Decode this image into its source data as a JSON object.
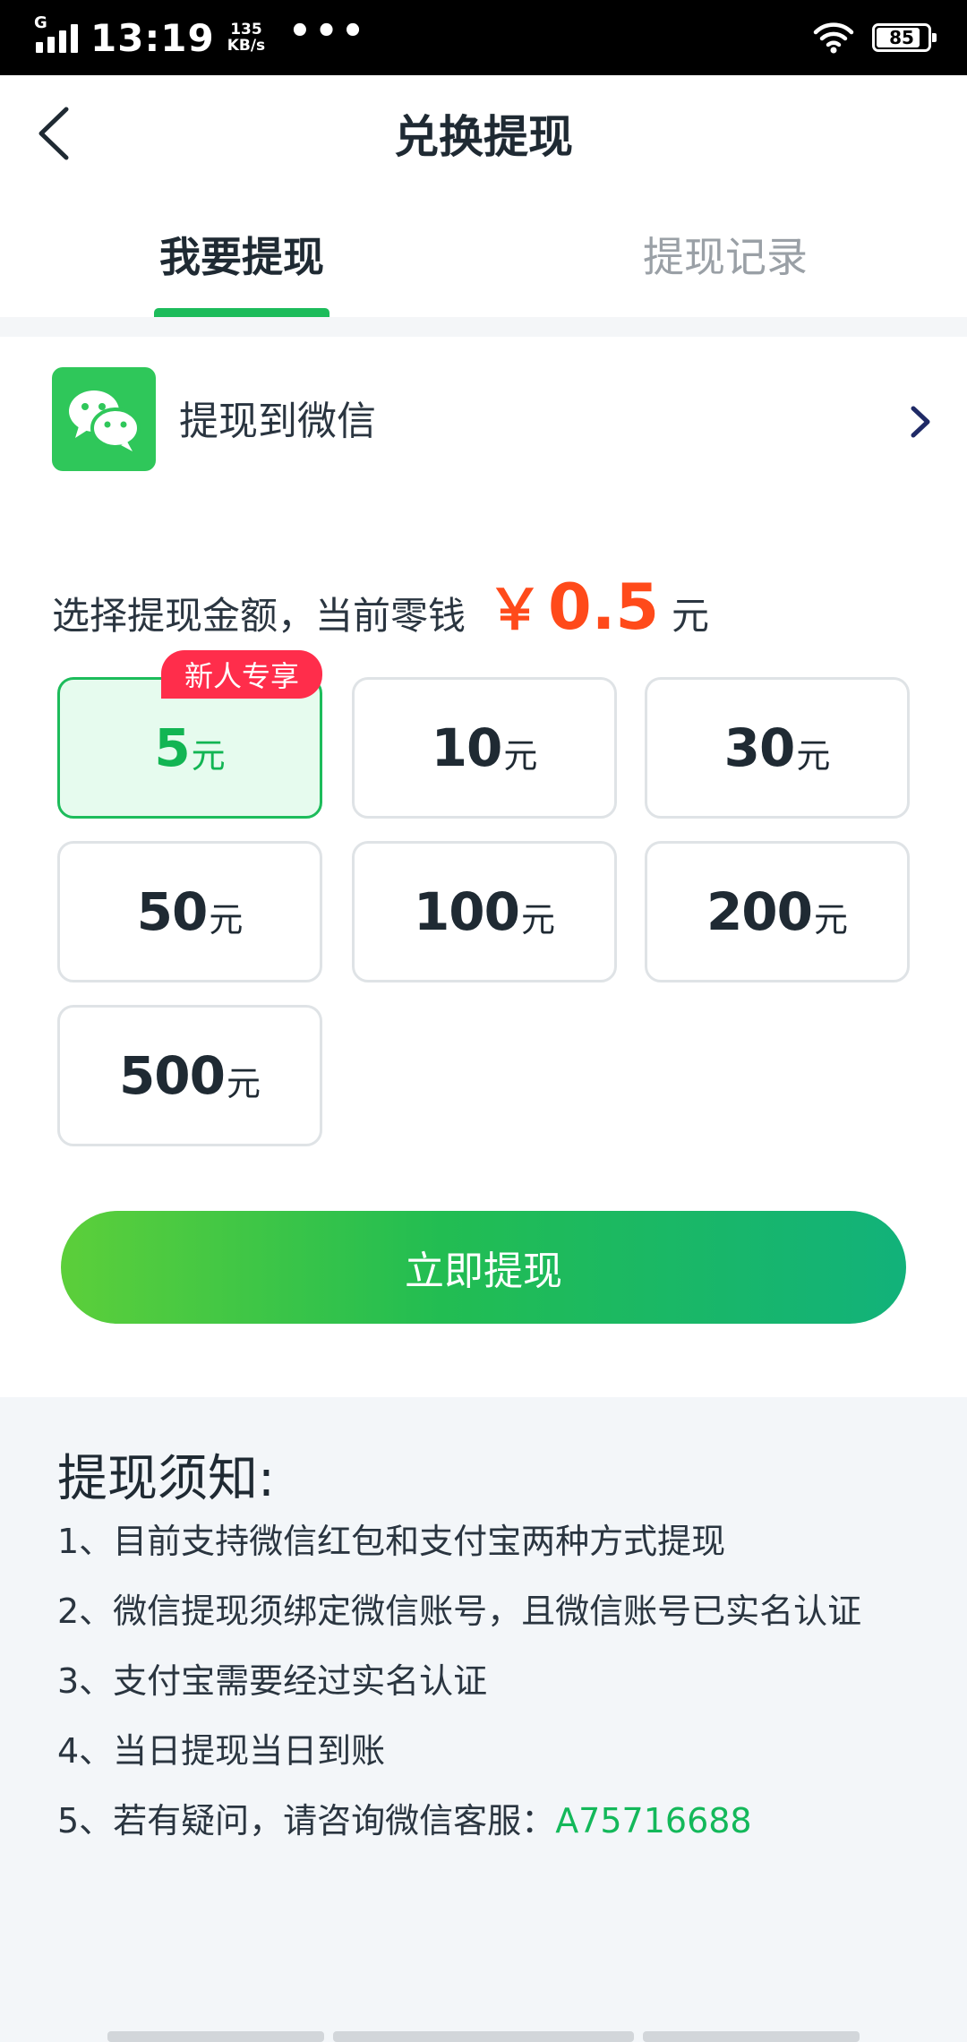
{
  "status_bar": {
    "network": "G",
    "time": "13:19",
    "speed_value": "135",
    "speed_unit": "KB/s",
    "more": "•••",
    "battery": "85",
    "battery_level": 0.85
  },
  "header": {
    "back_icon": "back-arrow-icon",
    "title": "兑换提现"
  },
  "tabs": [
    {
      "label": "我要提现",
      "active": true
    },
    {
      "label": "提现记录",
      "active": false
    }
  ],
  "withdraw_method": {
    "icon": "wechat-icon",
    "label": "提现到微信",
    "chevron_icon": "chevron-right-icon"
  },
  "amount": {
    "label": "选择提现金额，当前零钱",
    "currency_symbol": "￥",
    "balance": "0.5",
    "unit": "元"
  },
  "options": [
    {
      "value": "5",
      "unit": "元",
      "selected": true,
      "badge": "新人专享"
    },
    {
      "value": "10",
      "unit": "元"
    },
    {
      "value": "30",
      "unit": "元"
    },
    {
      "value": "50",
      "unit": "元"
    },
    {
      "value": "100",
      "unit": "元"
    },
    {
      "value": "200",
      "unit": "元"
    },
    {
      "value": "500",
      "unit": "元"
    }
  ],
  "cta": {
    "label": "立即提现"
  },
  "notice": {
    "title": "提现须知:",
    "items": [
      "1、目前支持微信红包和支付宝两种方式提现",
      "2、微信提现须绑定微信账号，且微信账号已实名认证",
      "3、支付宝需要经过实名认证",
      "4、当日提现当日到账",
      "5、若有疑问，请咨询微信客服："
    ],
    "contact": "A75716688"
  },
  "colors": {
    "accent": "#1dbc5b",
    "price": "#ff4a1a",
    "badge": "#ff2d4b"
  }
}
